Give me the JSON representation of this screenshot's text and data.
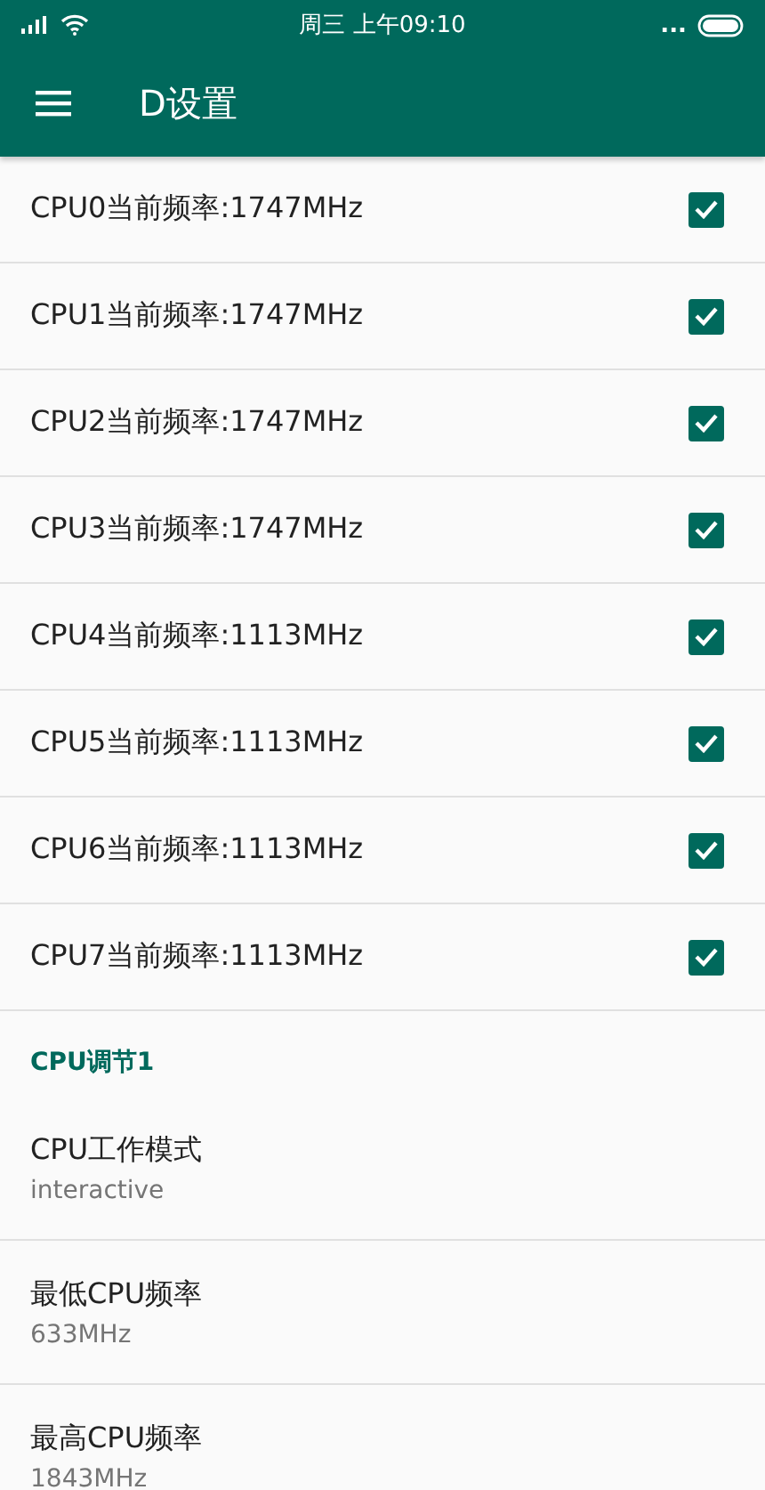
{
  "status_bar": {
    "time": "周三 上午09:10",
    "more": "..."
  },
  "toolbar": {
    "title": "D设置"
  },
  "cpu_items": [
    {
      "label": "CPU0当前频率:1747MHz",
      "checked": true
    },
    {
      "label": "CPU1当前频率:1747MHz",
      "checked": true
    },
    {
      "label": "CPU2当前频率:1747MHz",
      "checked": true
    },
    {
      "label": "CPU3当前频率:1747MHz",
      "checked": true
    },
    {
      "label": "CPU4当前频率:1113MHz",
      "checked": true
    },
    {
      "label": "CPU5当前频率:1113MHz",
      "checked": true
    },
    {
      "label": "CPU6当前频率:1113MHz",
      "checked": true
    },
    {
      "label": "CPU7当前频率:1113MHz",
      "checked": true
    }
  ],
  "section": {
    "title": "CPU调节1",
    "items": [
      {
        "title": "CPU工作模式",
        "summary": "interactive"
      },
      {
        "title": "最低CPU频率",
        "summary": "633MHz"
      },
      {
        "title": "最高CPU频率",
        "summary": "1843MHz"
      }
    ]
  }
}
